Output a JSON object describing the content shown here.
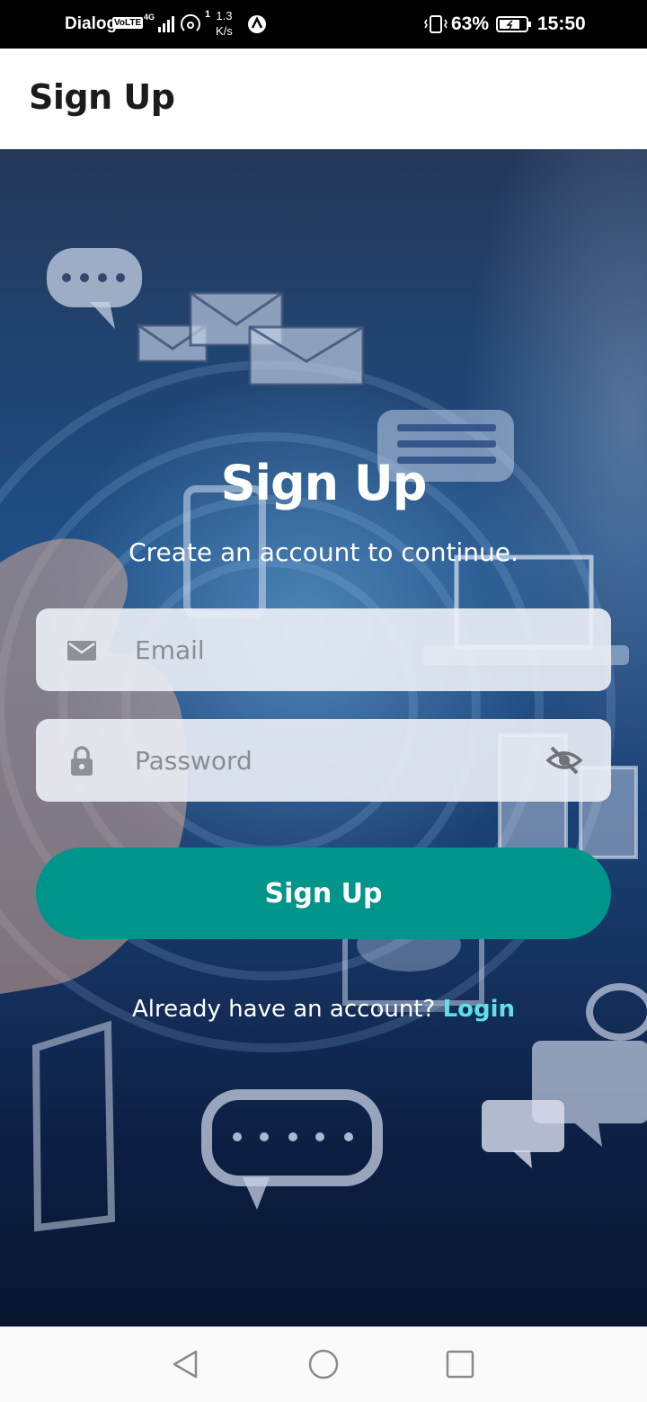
{
  "status_bar": {
    "carrier": "Dialog",
    "volte": "VoLTE",
    "network": "4G",
    "notif_count": "1",
    "speed_value": "1.3",
    "speed_unit": "K/s",
    "battery_percent": "63%",
    "time": "15:50"
  },
  "app_bar": {
    "title": "Sign Up"
  },
  "hero": {
    "title": "Sign Up",
    "subtitle": "Create an account to continue."
  },
  "form": {
    "email": {
      "value": "",
      "placeholder": "Email",
      "icon": "mail-icon"
    },
    "password": {
      "value": "",
      "placeholder": "Password",
      "icon": "lock-icon",
      "toggle_icon": "eye-off-icon"
    },
    "submit_label": "Sign Up"
  },
  "footer": {
    "prompt": "Already have an account?",
    "login_label": "Login"
  },
  "colors": {
    "accent": "#00958a",
    "link": "#5fe0e6",
    "field_bg": "#ecf0f6"
  },
  "nav_bar": {
    "back_icon": "back-triangle-icon",
    "home_icon": "home-circle-icon",
    "recent_icon": "recent-square-icon"
  }
}
